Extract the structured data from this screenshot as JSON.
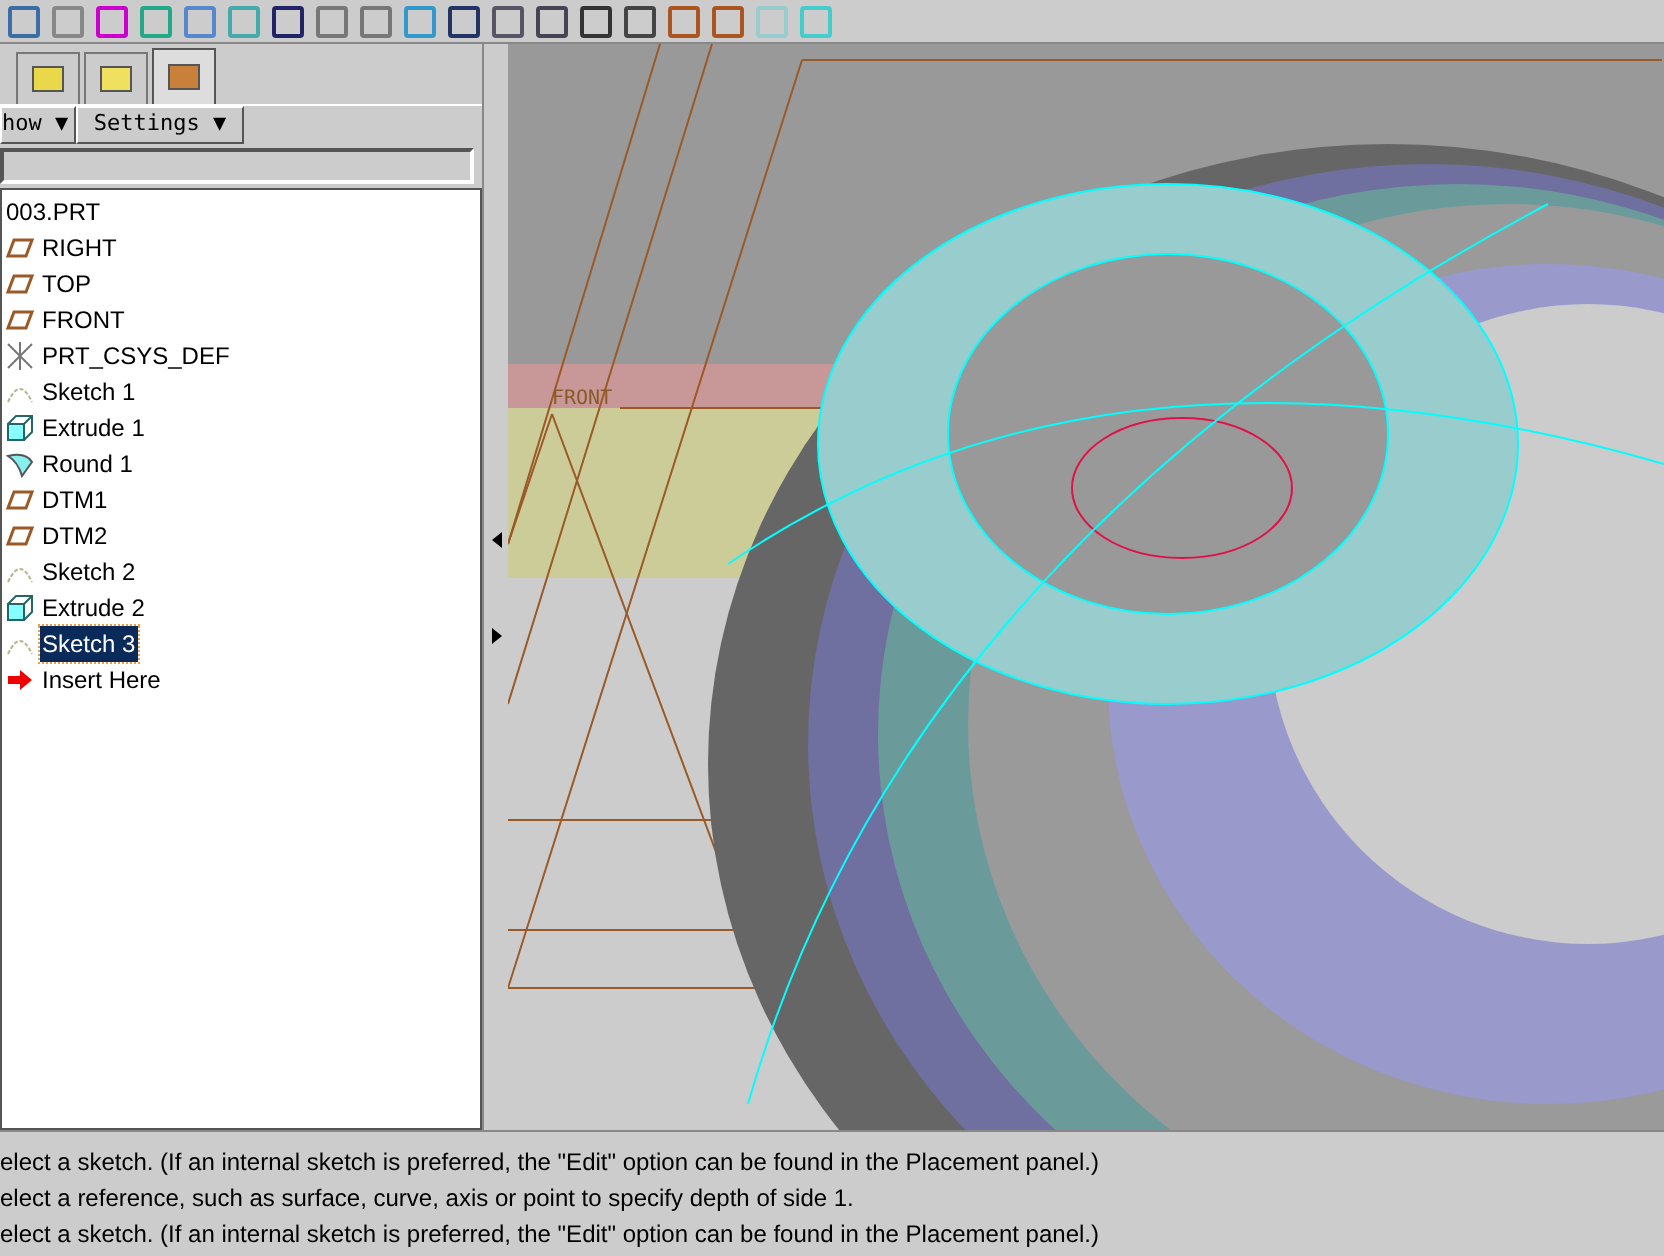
{
  "navigator_tabs": [
    {
      "selected": false
    },
    {
      "selected": false
    },
    {
      "selected": true
    }
  ],
  "tree_toolbar": {
    "buttons": [
      {
        "label": "how ▼"
      },
      {
        "label": "Settings ▼"
      }
    ]
  },
  "model_tree": {
    "root": {
      "label": "003.PRT",
      "children": [
        {
          "label": "RIGHT",
          "kind": "plane",
          "selected": false
        },
        {
          "label": "TOP",
          "kind": "plane",
          "selected": false
        },
        {
          "label": "FRONT",
          "kind": "plane",
          "selected": false
        },
        {
          "label": "PRT_CSYS_DEF",
          "kind": "csys",
          "selected": false
        },
        {
          "label": "Sketch 1",
          "kind": "sketch",
          "selected": false
        },
        {
          "label": "Extrude 1",
          "kind": "extrude",
          "selected": false
        },
        {
          "label": "Round 1",
          "kind": "round",
          "selected": false
        },
        {
          "label": "DTM1",
          "kind": "plane",
          "selected": false
        },
        {
          "label": "DTM2",
          "kind": "plane",
          "selected": false
        },
        {
          "label": "Sketch 2",
          "kind": "sketch",
          "selected": false
        },
        {
          "label": "Extrude 2",
          "kind": "extrude",
          "selected": false
        },
        {
          "label": "Sketch 3",
          "kind": "sketch",
          "selected": true
        },
        {
          "label": "Insert Here",
          "kind": "insert",
          "selected": false
        }
      ]
    }
  },
  "viewport": {
    "datum_label": "FRONT"
  },
  "message_area": [
    "elect a sketch. (If an internal sketch is preferred, the \"Edit\" option can be found in the Placement panel.)",
    "elect a reference, such as surface, curve, axis or point to specify depth of side 1.",
    "elect a sketch. (If an internal sketch is preferred, the \"Edit\" option can be found in the Placement panel.)"
  ]
}
